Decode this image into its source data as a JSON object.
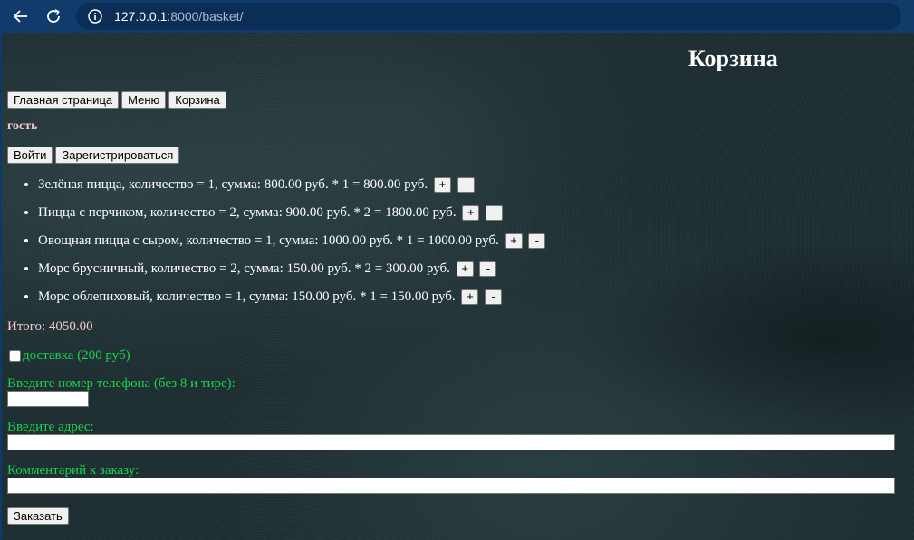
{
  "browser": {
    "url_host": "127.0.0.1",
    "url_path": ":8000/basket/",
    "icons": [
      "back-arrow-icon",
      "reload-icon",
      "info-icon"
    ]
  },
  "page": {
    "title": "Корзина",
    "nav": {
      "home_label": "Главная страница",
      "menu_label": "Меню",
      "basket_label": "Корзина"
    },
    "user_status": "гость",
    "auth": {
      "login_label": "Войти",
      "register_label": "Зарегистрироваться"
    },
    "items": [
      {
        "text": "Зелёная пицца, количество = 1, сумма: 800.00 руб. * 1 = 800.00 руб.",
        "plus": "+",
        "minus": "-"
      },
      {
        "text": "Пицца с перчиком, количество = 2, сумма: 900.00 руб. * 2 = 1800.00 руб.",
        "plus": "+",
        "minus": "-"
      },
      {
        "text": "Овощная пицца с сыром, количество = 1, сумма: 1000.00 руб. * 1 = 1000.00 руб.",
        "plus": "+",
        "minus": "-"
      },
      {
        "text": "Морс брусничный, количество = 2, сумма: 150.00 руб. * 2 = 300.00 руб.",
        "plus": "+",
        "minus": "-"
      },
      {
        "text": "Морс облепиховый, количество = 1, сумма: 150.00 руб. * 1 = 150.00 руб.",
        "plus": "+",
        "minus": "-"
      }
    ],
    "total": "Итого: 4050.00",
    "delivery": {
      "label": "доставка (200 руб)",
      "checked": false
    },
    "form": {
      "phone_label": "Введите номер телефона (без 8 и тире):",
      "phone_value": "",
      "address_label": "Введите адрес:",
      "address_value": "",
      "comment_label": "Комментарий к заказу:",
      "comment_value": "",
      "submit_label": "Заказать"
    },
    "colors": {
      "green_label": "#19d34a",
      "pink_text": "#f0c8c8",
      "browser_bar": "#103b6a"
    }
  }
}
